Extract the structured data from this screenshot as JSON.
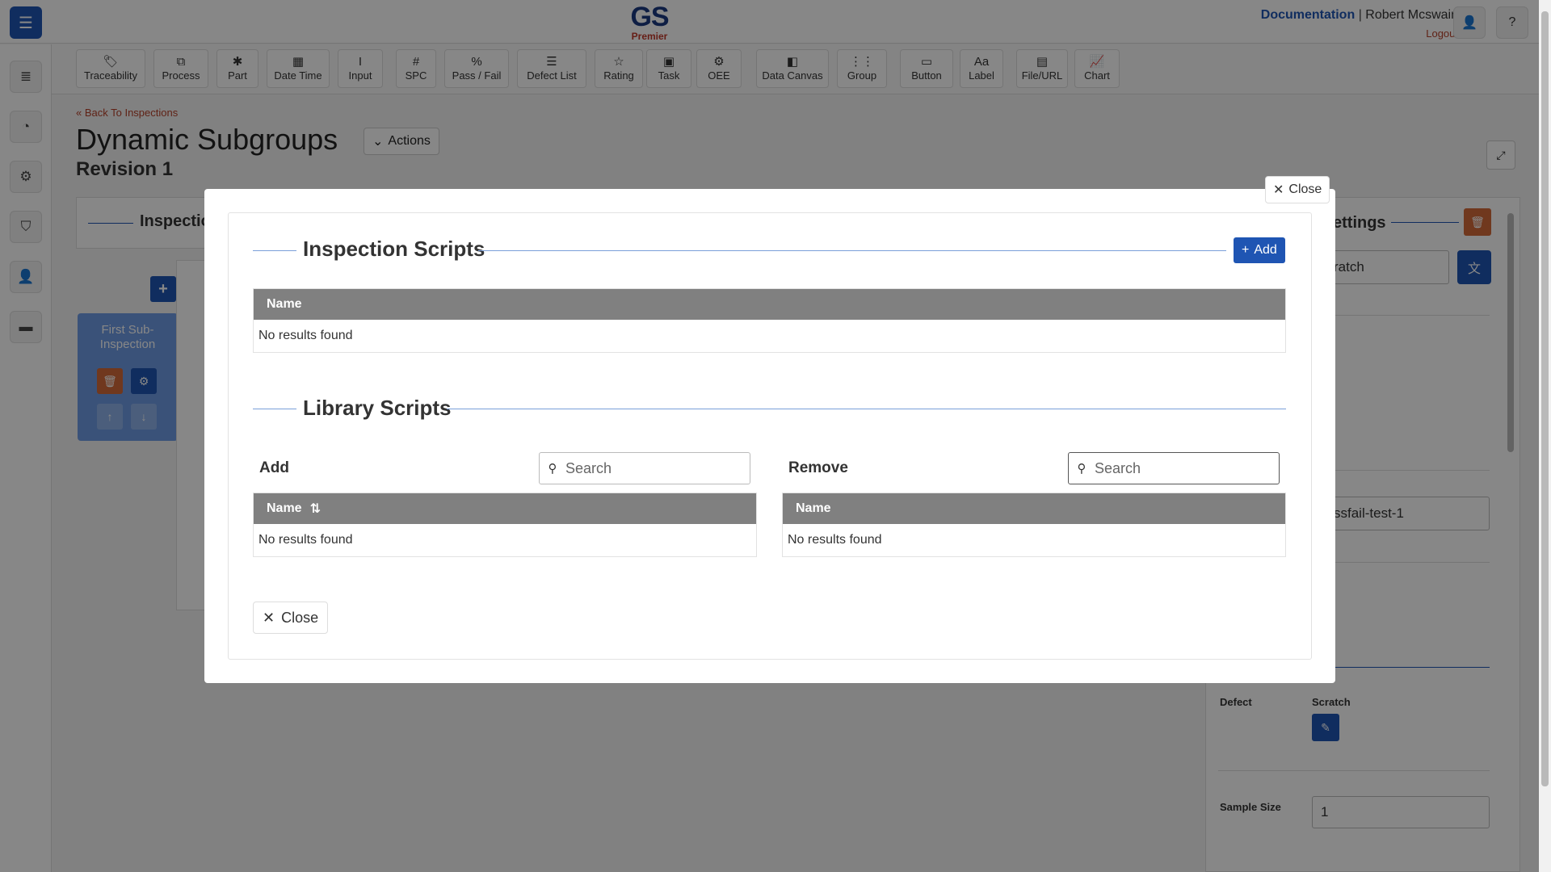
{
  "header": {
    "logo_main": "GS",
    "logo_sub": "Premier",
    "documentation_link": "Documentation",
    "separator": "|",
    "user_name": "Robert Mcswain",
    "logout_link": "Logout"
  },
  "toolbar": {
    "items": [
      {
        "label": "Traceability",
        "icon": "tag-icon",
        "glyph": "🏷"
      },
      {
        "label": "Process",
        "icon": "process-icon",
        "glyph": "⧉"
      },
      {
        "label": "Part",
        "icon": "puzzle-icon",
        "glyph": "✱"
      },
      {
        "label": "Date Time",
        "icon": "calendar-icon",
        "glyph": "▦"
      },
      {
        "label": "Input",
        "icon": "text-cursor-icon",
        "glyph": "I"
      },
      {
        "label": "SPC",
        "icon": "hash-icon",
        "glyph": "#"
      },
      {
        "label": "Pass / Fail",
        "icon": "percent-icon",
        "glyph": "%"
      },
      {
        "label": "Defect List",
        "icon": "list-icon",
        "glyph": "☰"
      },
      {
        "label": "Rating",
        "icon": "star-icon",
        "glyph": "☆"
      },
      {
        "label": "Task",
        "icon": "clipboard-icon",
        "glyph": "▣"
      },
      {
        "label": "OEE",
        "icon": "oee-icon",
        "glyph": "⚙"
      },
      {
        "label": "Data Canvas",
        "icon": "canvas-icon",
        "glyph": "◧"
      },
      {
        "label": "Group",
        "icon": "grid-icon",
        "glyph": "⋮⋮"
      },
      {
        "label": "Button",
        "icon": "button-icon",
        "glyph": "▭"
      },
      {
        "label": "Label",
        "icon": "text-icon",
        "glyph": "Aa"
      },
      {
        "label": "File/URL",
        "icon": "file-icon",
        "glyph": "▤"
      },
      {
        "label": "Chart",
        "icon": "chart-icon",
        "glyph": "📈"
      }
    ]
  },
  "page": {
    "back_link": "Back To Inspections",
    "title": "Dynamic Subgroups",
    "actions_label": "Actions",
    "revision": "Revision 1",
    "inspection_panel_title": "Inspectio",
    "sub_inspection_name": "First Sub-Inspection"
  },
  "settings": {
    "title": "ettings",
    "field1_value": "ratch",
    "field2_value": "ssfail-test-1",
    "defect_label": "Defect",
    "defect_value": "Scratch",
    "sample_size_label": "Sample Size",
    "sample_size_value": "1"
  },
  "modal": {
    "close_top_label": "Close",
    "inspection_scripts": {
      "title": "Inspection Scripts",
      "add_label": "Add",
      "column_name": "Name",
      "empty_text": "No results found"
    },
    "library_scripts": {
      "title": "Library Scripts",
      "add_panel": {
        "title": "Add",
        "search_placeholder": "Search",
        "column_name": "Name",
        "empty_text": "No results found"
      },
      "remove_panel": {
        "title": "Remove",
        "search_placeholder": "Search",
        "column_name": "Name",
        "empty_text": "No results found"
      }
    },
    "close_bottom_label": "Close"
  },
  "colors": {
    "primary": "#1f55b3",
    "danger": "#d46a3a",
    "table_header": "#808080",
    "accent_red": "#b5412a"
  }
}
